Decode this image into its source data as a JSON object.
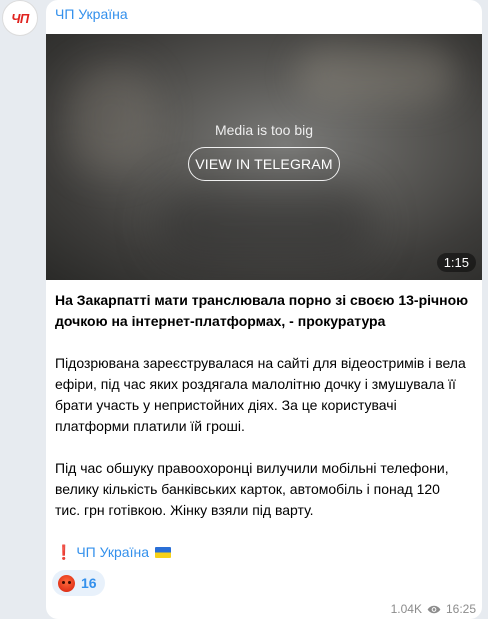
{
  "channel": {
    "avatar_text": "ЧП",
    "name": "ЧП Україна"
  },
  "media": {
    "message": "Media is too big",
    "button_label": "VIEW IN TELEGRAM",
    "duration": "1:15"
  },
  "post": {
    "headline_line1": "На Закарпатті мати транслювала порно зі своєю 13-річною",
    "headline_line2": "дочкою на інтернет-платформах, - прокуратура",
    "para1_line1": "Підозрювана зареєструвалася на сайті для відеостримів і вела",
    "para1_line2": "ефіри, під час яких роздягала малолітню дочку і змушувала її",
    "para1_line3": "брати участь у непристойних діях. За це користувачі",
    "para1_line4": "платформи платили їй гроші.",
    "para2_line1": "Під час обшуку правоохоронці вилучили мобільні телефони,",
    "para2_line2": "велику кількість банківських карток, автомобіль і понад 120",
    "para2_line3": "тис. грн готівкою. Жінку взяли під варту.",
    "signature_mark": "❗",
    "signature_text": "ЧП Україна"
  },
  "reaction": {
    "icon": "angry-face-icon",
    "count": "16"
  },
  "meta": {
    "views": "1.04K",
    "time": "16:25"
  },
  "colors": {
    "accent": "#3390ec",
    "brand_red": "#e0231f",
    "background": "#e7ebf0"
  }
}
